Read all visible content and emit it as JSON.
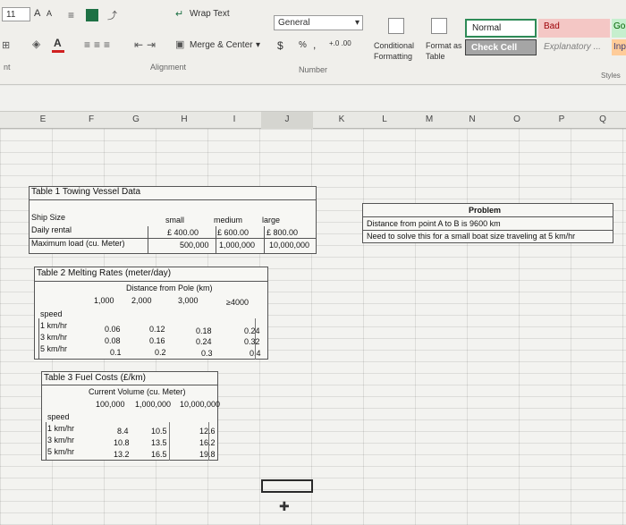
{
  "ribbon": {
    "font_size": "11",
    "font_grow": "A",
    "font_shrink": "A",
    "wrap_text": "Wrap Text",
    "merge_center": "Merge & Center",
    "alignment_group": "Alignment",
    "number_format": "General",
    "currency": "$",
    "percent": "%",
    "comma": ",",
    "number_group": "Number",
    "conditional_formatting": "Conditional Formatting",
    "format_as_table": "Format as Table",
    "style_normal": "Normal",
    "style_bad": "Bad",
    "style_good": "Go",
    "style_check_cell": "Check Cell",
    "style_explanatory": "Explanatory ...",
    "style_input": "Inp",
    "styles_group": "Styles",
    "left_group_fragment": "nt"
  },
  "columns": [
    "E",
    "F",
    "G",
    "H",
    "I",
    "J",
    "K",
    "L",
    "M",
    "N",
    "O",
    "P",
    "Q"
  ],
  "table1": {
    "title": "Table 1 Towing Vessel Data",
    "rows": [
      {
        "label": "Ship Size",
        "c1": "small",
        "c2": "medium",
        "c3": "large"
      },
      {
        "label": "Daily rental",
        "c1": "£  400.00",
        "c2": "£  600.00",
        "c3": "£    800.00"
      },
      {
        "label": "Maximum load (cu. Meter)",
        "c1": "500,000",
        "c2": "1,000,000",
        "c3": "10,000,000"
      }
    ]
  },
  "table2": {
    "title": "Table 2 Melting Rates (meter/day)",
    "subtitle": "Distance from Pole (km)",
    "headers": [
      "1,000",
      "2,000",
      "3,000",
      "≥4000"
    ],
    "speed_label": "speed",
    "rows": [
      {
        "label": "1 km/hr",
        "values": [
          "0.06",
          "0.12",
          "0.18",
          "0.24"
        ]
      },
      {
        "label": "3 km/hr",
        "values": [
          "0.08",
          "0.16",
          "0.24",
          "0.32"
        ]
      },
      {
        "label": "5 km/hr",
        "values": [
          "0.1",
          "0.2",
          "0.3",
          "0.4"
        ]
      }
    ]
  },
  "table3": {
    "title": "Table 3 Fuel Costs (£/km)",
    "subtitle": "Current Volume (cu. Meter)",
    "headers": [
      "100,000",
      "1,000,000",
      "10,000,000"
    ],
    "speed_label": "speed",
    "rows": [
      {
        "label": "1 km/hr",
        "values": [
          "8.4",
          "10.5",
          "12.6"
        ]
      },
      {
        "label": "3 km/hr",
        "values": [
          "10.8",
          "13.5",
          "16.2"
        ]
      },
      {
        "label": "5 km/hr",
        "values": [
          "13.2",
          "16.5",
          "19.8"
        ]
      }
    ]
  },
  "problem": {
    "title": "Problem",
    "line1": "Distance from point A to B is 9600 km",
    "line2": "Need to solve this for a small boat size traveling at 5 km/hr"
  },
  "colors": {
    "accent_green": "#217346",
    "bad_fill": "#f4c7c5",
    "check_fill": "#a5a5a5",
    "good_fill": "#c6efce"
  }
}
